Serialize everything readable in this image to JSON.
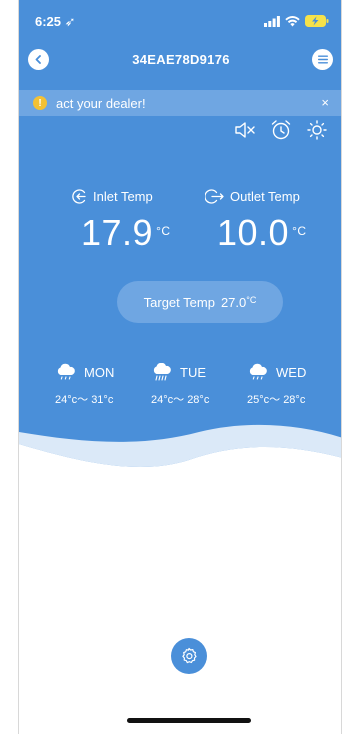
{
  "status_bar": {
    "time": "6:25",
    "location_icon": "location-arrow-icon"
  },
  "header": {
    "title": "34EAE78D9176",
    "back_icon": "back-chevron-icon",
    "menu_icon": "menu-icon"
  },
  "banner": {
    "text": "act your dealer!",
    "close": "×",
    "warn_glyph": "!"
  },
  "toolbar": {
    "mute_icon": "speaker-mute-icon",
    "alarm_icon": "alarm-clock-icon",
    "brightness_icon": "sun-icon"
  },
  "temperatures": {
    "inlet": {
      "label": "Inlet Temp",
      "value": "17.9",
      "unit": "°C"
    },
    "outlet": {
      "label": "Outlet Temp",
      "value": "10.0",
      "unit": "°C"
    }
  },
  "target": {
    "label": "Target Temp",
    "value": "27.0",
    "unit": "°C"
  },
  "forecast": [
    {
      "day": "MON",
      "range": "24°c～ 31°c",
      "icon": "cloud-rain-icon"
    },
    {
      "day": "TUE",
      "range": "24°c～ 28°c",
      "icon": "cloud-heavy-rain-icon"
    },
    {
      "day": "WED",
      "range": "25°c～ 28°c",
      "icon": "cloud-rain-icon"
    }
  ],
  "colors": {
    "primary": "#4a8fd9",
    "banner": "#6fa6e2",
    "warning": "#f3c135"
  }
}
